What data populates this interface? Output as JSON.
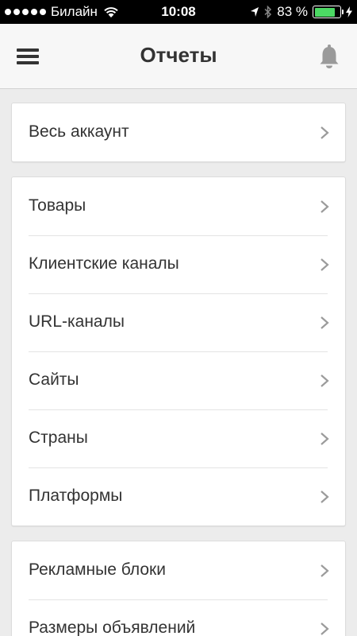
{
  "status_bar": {
    "carrier": "Билайн",
    "time": "10:08",
    "battery_percent": "83 %",
    "battery_level": 0.83,
    "battery_color": "#4cd964"
  },
  "header": {
    "title": "Отчеты",
    "menu_icon": "hamburger-icon",
    "notifications_icon": "bell-icon"
  },
  "sections": [
    {
      "items": [
        {
          "label": "Весь аккаунт"
        }
      ]
    },
    {
      "items": [
        {
          "label": "Товары"
        },
        {
          "label": "Клиентские каналы"
        },
        {
          "label": "URL-каналы"
        },
        {
          "label": "Сайты"
        },
        {
          "label": "Страны"
        },
        {
          "label": "Платформы"
        }
      ]
    },
    {
      "items": [
        {
          "label": "Рекламные блоки"
        },
        {
          "label": "Размеры объявлений"
        }
      ]
    }
  ]
}
